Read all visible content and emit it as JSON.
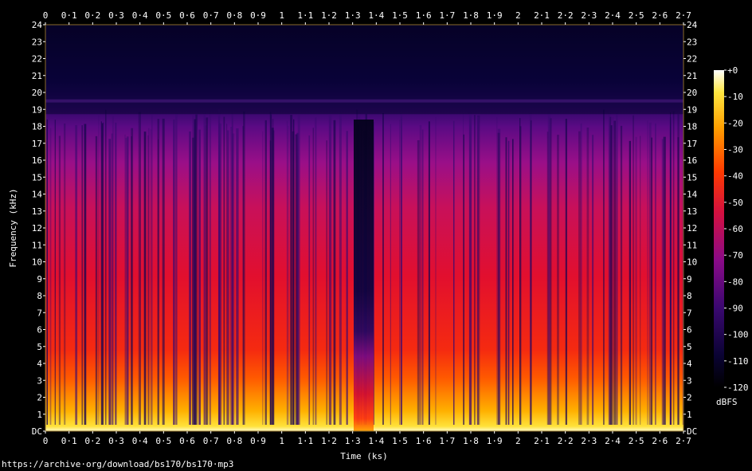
{
  "chart_data": {
    "type": "heatmap",
    "title": "",
    "xlabel": "Time (ks)",
    "ylabel": "Frequency (kHz)",
    "xlim": [
      0,
      2.7
    ],
    "ylim": [
      0,
      24
    ],
    "x_ticks": [
      "0",
      "0·1",
      "0·2",
      "0·3",
      "0·4",
      "0·5",
      "0·6",
      "0·7",
      "0·8",
      "0·9",
      "1",
      "1·1",
      "1·2",
      "1·3",
      "1·4",
      "1·5",
      "1·6",
      "1·7",
      "1·8",
      "1·9",
      "2",
      "2·1",
      "2·2",
      "2·3",
      "2·4",
      "2·5",
      "2·6",
      "2·7"
    ],
    "y_ticks": [
      "DC",
      "1",
      "2",
      "3",
      "4",
      "5",
      "6",
      "7",
      "8",
      "9",
      "10",
      "11",
      "12",
      "13",
      "14",
      "15",
      "16",
      "17",
      "18",
      "19",
      "20",
      "21",
      "22",
      "23",
      "24"
    ],
    "colorbar": {
      "label": "dBFS",
      "ticks": [
        "+0",
        "-10",
        "-20",
        "-30",
        "-40",
        "-50",
        "-60",
        "-70",
        "-80",
        "-90",
        "-100",
        "-110",
        "-120"
      ],
      "range": [
        -120,
        0
      ]
    },
    "bandwidth_cutoff_khz": 19,
    "quiet_segment_ks": [
      1.31,
      1.39
    ],
    "grid": false
  },
  "source_url": "https://archive·org/download/bs170/bs170·mp3"
}
